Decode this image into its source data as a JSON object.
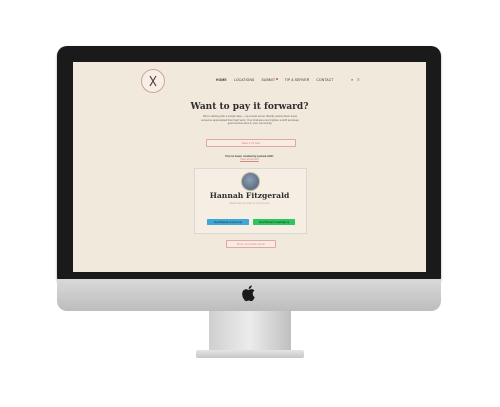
{
  "nav": {
    "items": [
      {
        "label": "HOME",
        "active": true
      },
      {
        "label": "LOCATIONS",
        "active": false
      },
      {
        "label": "SUBMIT",
        "active": false,
        "dot": true
      },
      {
        "label": "TIP A SERVER",
        "active": false
      },
      {
        "label": "CONTACT",
        "active": false
      }
    ],
    "icons": [
      "search-icon",
      "menu-icon"
    ]
  },
  "hero": {
    "title": "Want to pay it forward?",
    "text": "We're starting with a simple idea — tip a local server directly and let them know someone appreciated their hard work. Your kindness can brighten a shift and keep good service alive in your community.",
    "button": "Make a Tip Now"
  },
  "recent": {
    "label": "You've been randomly paired with:",
    "link": "View all servers"
  },
  "profile": {
    "name": "Hannah Fitzgerald",
    "subtitle": "Bartender at Grain & Tap House",
    "button_left": "Send Hannah a Venmo tip",
    "button_right": "Send Hannah a CashApp tip"
  },
  "footer_button": "Show me another server",
  "colors": {
    "screen_bg": "#f1e9dc",
    "accent": "#d98b8b",
    "venmo": "#3fa7d6",
    "cashapp": "#2ec45f"
  }
}
